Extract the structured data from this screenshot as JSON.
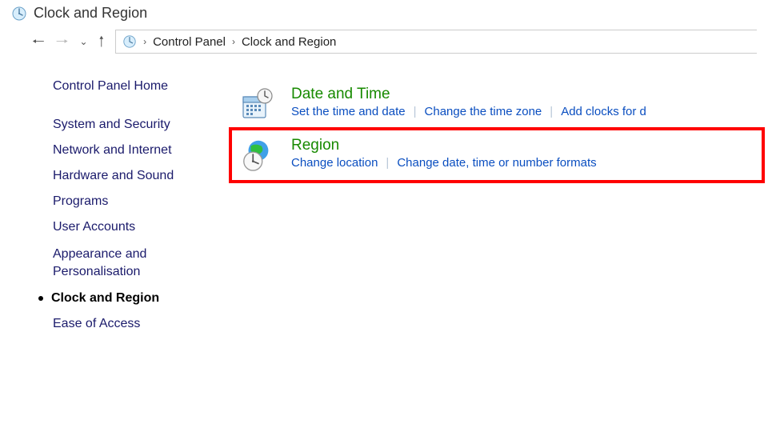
{
  "window": {
    "title": "Clock and Region"
  },
  "breadcrumb": {
    "items": [
      "Control Panel",
      "Clock and Region"
    ]
  },
  "sidebar": {
    "home": "Control Panel Home",
    "items": [
      {
        "label": "System and Security"
      },
      {
        "label": "Network and Internet"
      },
      {
        "label": "Hardware and Sound"
      },
      {
        "label": "Programs"
      },
      {
        "label": "User Accounts"
      },
      {
        "label": "Appearance and Personalisation"
      },
      {
        "label": "Clock and Region",
        "current": true
      },
      {
        "label": "Ease of Access"
      }
    ]
  },
  "content": {
    "categories": [
      {
        "title": "Date and Time",
        "tasks": [
          "Set the time and date",
          "Change the time zone",
          "Add clocks for d"
        ]
      },
      {
        "title": "Region",
        "tasks": [
          "Change location",
          "Change date, time or number formats"
        ],
        "highlighted": true
      }
    ]
  }
}
